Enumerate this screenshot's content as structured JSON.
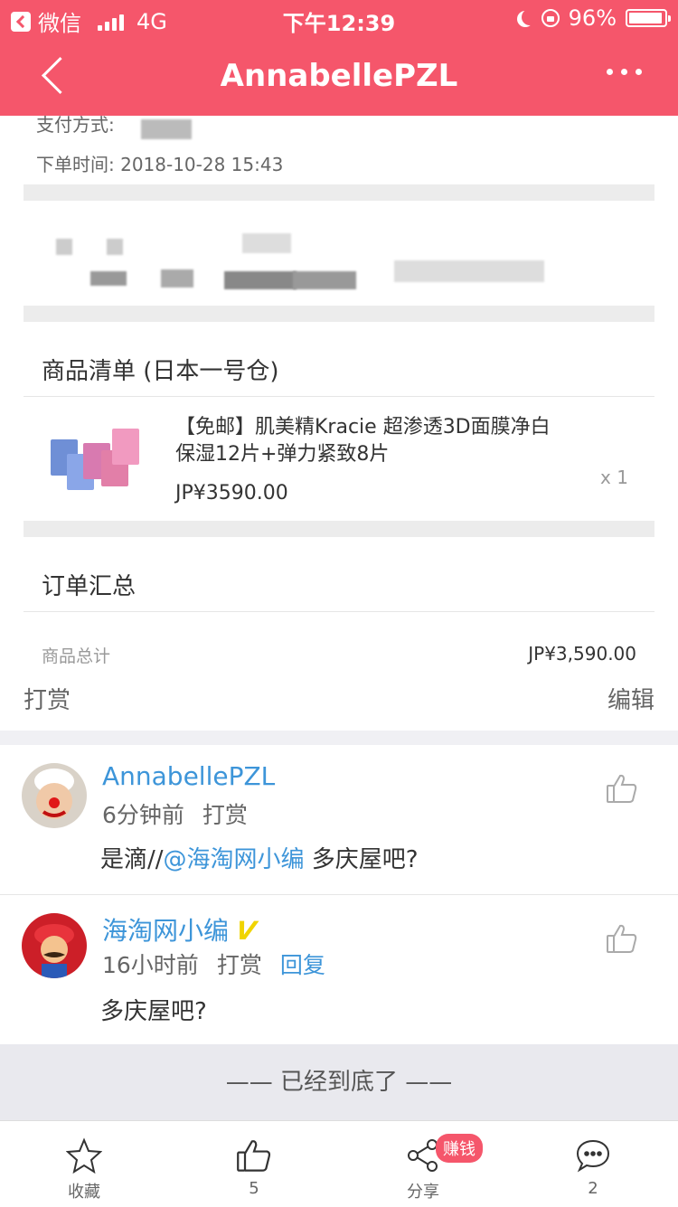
{
  "status_bar": {
    "app_label": "微信",
    "network": "4G",
    "time": "下午12:39",
    "battery_text": "96%",
    "battery_level": 0.96
  },
  "nav": {
    "title": "AnnabellePZL"
  },
  "order": {
    "payment_label": "支付方式:",
    "order_time": "下单时间: 2018-10-28 15:43",
    "items_heading": "商品清单 (日本一号仓)",
    "product": {
      "title": "【免邮】肌美精Kracie 超渗透3D面膜净白保湿12片+弹力紧致8片",
      "price": "JP¥3590.00",
      "qty": "x 1"
    },
    "summary_heading": "订单汇总",
    "total_label": "商品总计",
    "total_value": "JP¥3,590.00"
  },
  "actions": {
    "reward": "打赏",
    "edit": "编辑"
  },
  "comments": [
    {
      "author": "AnnabellePZL",
      "time": "6分钟前",
      "reward": "打赏",
      "text_prefix": "是滴//",
      "mention": "@海淘网小编",
      "text_suffix": " 多庆屋吧?"
    },
    {
      "author": "海淘网小编",
      "time": "16小时前",
      "reward": "打赏",
      "reply": "回复",
      "text": "多庆屋吧?"
    }
  ],
  "end_text": "—— 已经到底了 ——",
  "tab_bar": {
    "favorite": "收藏",
    "likes": "5",
    "share": "分享",
    "earn_badge": "赚钱",
    "comments": "2"
  },
  "colors": {
    "brand": "#f5566b",
    "link": "#3d95d9"
  }
}
